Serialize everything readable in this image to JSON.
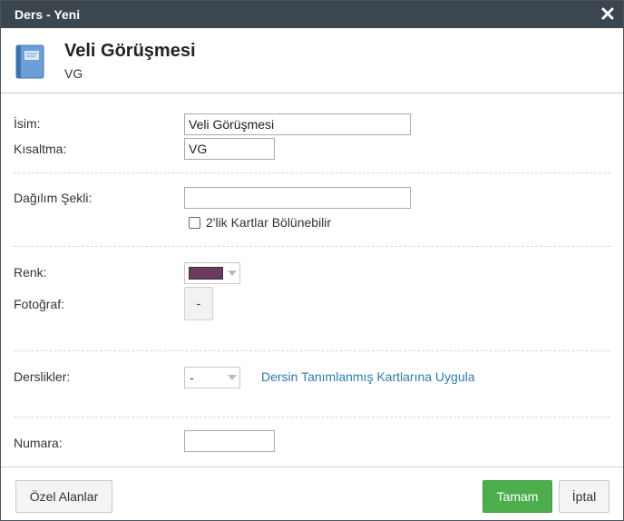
{
  "window": {
    "title": "Ders - Yeni"
  },
  "header": {
    "name": "Veli Görüşmesi",
    "short": "VG"
  },
  "form": {
    "name_label": "İsim:",
    "name_value": "Veli Görüşmesi",
    "short_label": "Kısaltma:",
    "short_value": "VG",
    "distribution_label": "Dağılım Şekli:",
    "distribution_value": "",
    "split_cards_label": "2'lik Kartlar Bölünebilir",
    "color_label": "Renk:",
    "color_value": "#6b3a5e",
    "photo_label": "Fotoğraf:",
    "photo_button": "-",
    "rooms_label": "Derslikler:",
    "rooms_value": "-",
    "apply_link": "Dersin Tanımlanmış Kartlarına Uygula",
    "number_label": "Numara:",
    "number_value": ""
  },
  "footer": {
    "custom_fields": "Özel Alanlar",
    "ok": "Tamam",
    "cancel": "İptal"
  },
  "icons": {
    "close": "close-icon",
    "book": "book-icon",
    "caret": "chevron-down-icon"
  },
  "colors": {
    "titlebar": "#3b464e",
    "ok_button": "#4cae4c",
    "link": "#2c7cb0",
    "book": "#6a9fd8"
  }
}
